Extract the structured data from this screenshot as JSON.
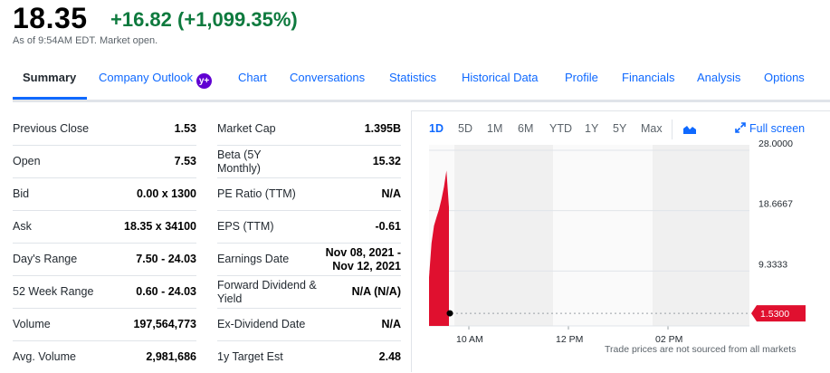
{
  "quote": {
    "price": "18.35",
    "change": "+16.82 (+1,099.35%)",
    "as_of": "As of 9:54AM EDT. Market open."
  },
  "tabs": [
    {
      "label": "Summary"
    },
    {
      "label": "Company Outlook",
      "badge": "y+"
    },
    {
      "label": "Chart"
    },
    {
      "label": "Conversations"
    },
    {
      "label": "Statistics"
    },
    {
      "label": "Historical Data"
    },
    {
      "label": "Profile"
    },
    {
      "label": "Financials"
    },
    {
      "label": "Analysis"
    },
    {
      "label": "Options"
    }
  ],
  "summary_left": [
    {
      "label": "Previous Close",
      "value": "1.53"
    },
    {
      "label": "Open",
      "value": "7.53"
    },
    {
      "label": "Bid",
      "value": "0.00 x 1300"
    },
    {
      "label": "Ask",
      "value": "18.35 x 34100"
    },
    {
      "label": "Day's Range",
      "value": "7.50 - 24.03"
    },
    {
      "label": "52 Week Range",
      "value": "0.60 - 24.03"
    },
    {
      "label": "Volume",
      "value": "197,564,773"
    },
    {
      "label": "Avg. Volume",
      "value": "2,981,686"
    }
  ],
  "summary_right": [
    {
      "label": "Market Cap",
      "value": "1.395B"
    },
    {
      "label": "Beta (5Y Monthly)",
      "value": "15.32"
    },
    {
      "label": "PE Ratio (TTM)",
      "value": "N/A"
    },
    {
      "label": "EPS (TTM)",
      "value": "-0.61"
    },
    {
      "label": "Earnings Date",
      "value": "Nov 08, 2021 - Nov 12, 2021"
    },
    {
      "label": "Forward Dividend & Yield",
      "value": "N/A (N/A)"
    },
    {
      "label": "Ex-Dividend Date",
      "value": "N/A"
    },
    {
      "label": "1y Target Est",
      "value": "2.48"
    }
  ],
  "chart": {
    "ranges": [
      "1D",
      "5D",
      "1M",
      "6M",
      "YTD",
      "1Y",
      "5Y",
      "Max"
    ],
    "active_range": "1D",
    "chart_type_icon": "mountain-chart-icon",
    "fullscreen_icon": "expand-arrows-icon",
    "fullscreen_label": "Full screen",
    "footnote": "Trade prices are not sourced from all markets",
    "colors": {
      "line": "#e0102f",
      "area": "#e0102f",
      "accent": "#0f69ff",
      "grid": "#e0e4e9",
      "shade": "#f0f0f0"
    }
  },
  "chart_data": {
    "type": "area",
    "y_tick_labels": [
      "28.0000",
      "18.6667",
      "9.3333"
    ],
    "ylim": [
      0,
      28
    ],
    "x_tick_labels": [
      "10 AM",
      "12 PM",
      "02 PM"
    ],
    "previous_close_label": "1.5300",
    "previous_close": 1.53,
    "x": [
      "09:30",
      "09:33",
      "09:36",
      "09:39",
      "09:42",
      "09:45",
      "09:48",
      "09:51",
      "09:54"
    ],
    "series": [
      {
        "values": [
          7.53,
          12.8,
          15.5,
          16.8,
          18.0,
          19.6,
          21.5,
          24.03,
          18.35
        ]
      }
    ]
  }
}
